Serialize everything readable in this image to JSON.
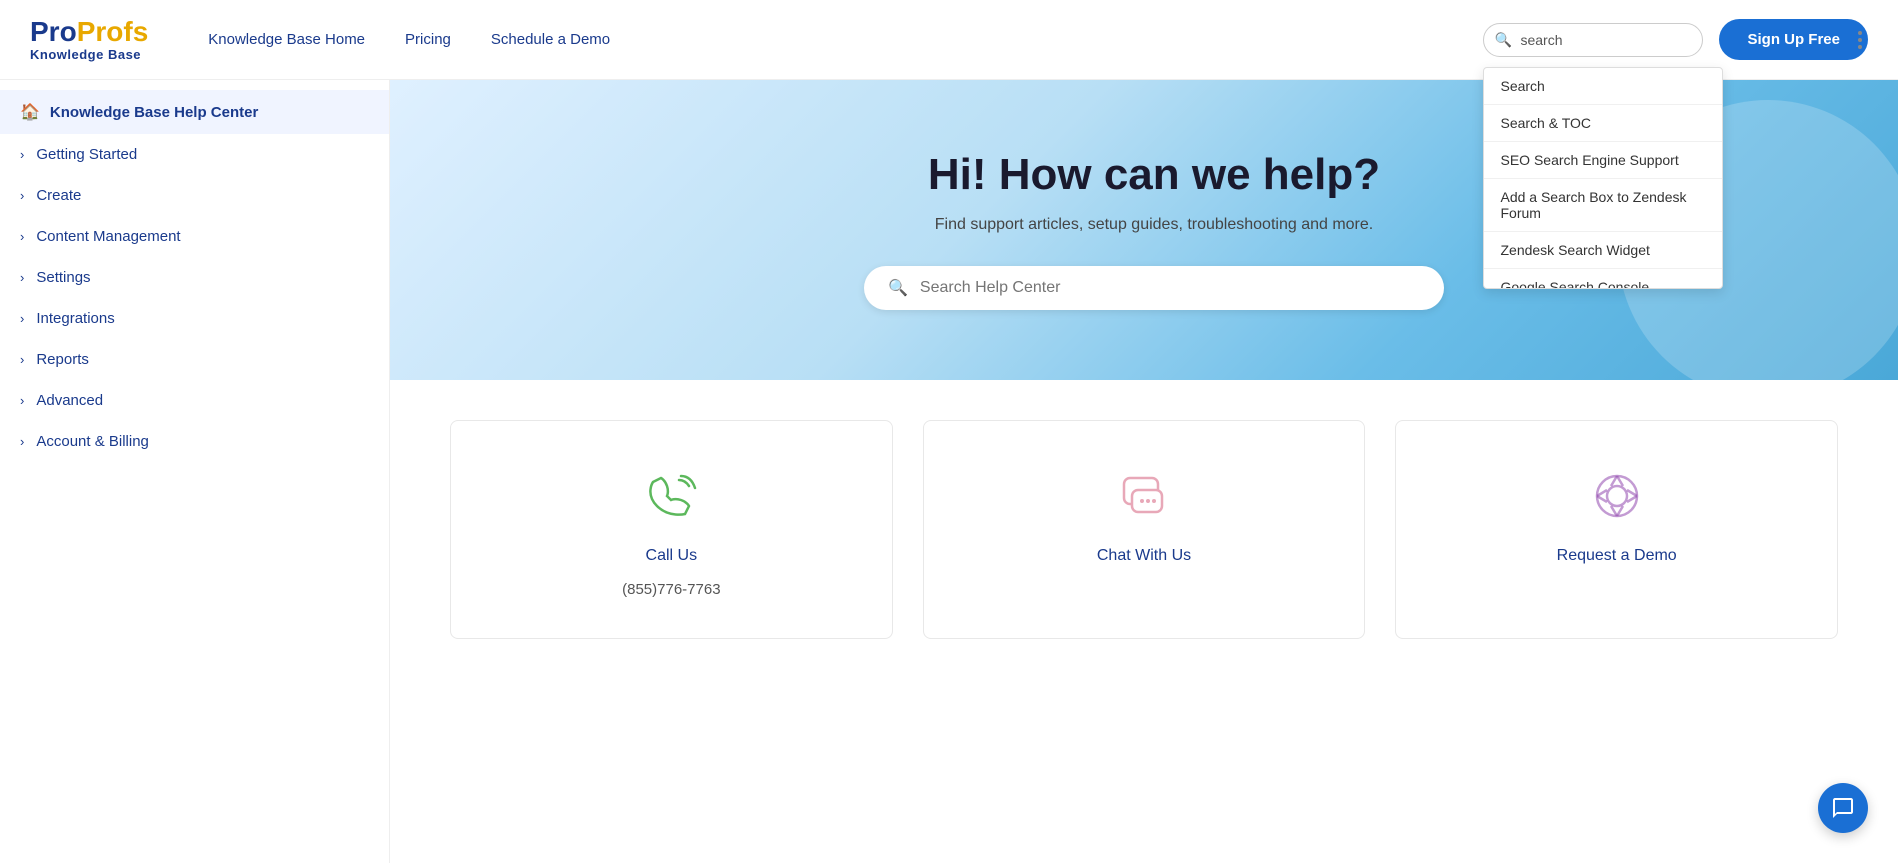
{
  "header": {
    "logo": {
      "pro": "Pro",
      "profs": "Profs",
      "sub": "Knowledge Base"
    },
    "nav": [
      {
        "label": "Knowledge Base Home",
        "id": "kb-home"
      },
      {
        "label": "Pricing",
        "id": "pricing"
      },
      {
        "label": "Schedule a Demo",
        "id": "schedule-demo"
      }
    ],
    "search_placeholder": "search",
    "signup_label": "Sign Up Free"
  },
  "dropdown": {
    "items": [
      {
        "label": "Search",
        "id": "search"
      },
      {
        "label": "Search & TOC",
        "id": "search-toc"
      },
      {
        "label": "SEO Search Engine Support",
        "id": "seo-search"
      },
      {
        "label": "Add a Search Box to Zendesk Forum",
        "id": "zendesk-forum"
      },
      {
        "label": "Zendesk Search Widget",
        "id": "zendesk-widget"
      },
      {
        "label": "Google Search Console",
        "id": "google-search"
      }
    ]
  },
  "sidebar": {
    "items": [
      {
        "label": "Knowledge Base Help Center",
        "id": "kb-help-center",
        "active": true,
        "icon": "home"
      },
      {
        "label": "Getting Started",
        "id": "getting-started"
      },
      {
        "label": "Create",
        "id": "create"
      },
      {
        "label": "Content Management",
        "id": "content-management"
      },
      {
        "label": "Settings",
        "id": "settings"
      },
      {
        "label": "Integrations",
        "id": "integrations"
      },
      {
        "label": "Reports",
        "id": "reports"
      },
      {
        "label": "Advanced",
        "id": "advanced"
      },
      {
        "label": "Account & Billing",
        "id": "account-billing"
      }
    ]
  },
  "hero": {
    "title": "Hi! How can we help?",
    "subtitle": "Find support articles, setup guides, troubleshooting and more.",
    "search_placeholder": "Search Help Center"
  },
  "cards": [
    {
      "id": "call-us",
      "label": "Call Us",
      "value": "(855)776-7763",
      "icon": "phone"
    },
    {
      "id": "chat-with-us",
      "label": "Chat With Us",
      "value": "",
      "icon": "chat"
    },
    {
      "id": "request-demo",
      "label": "Request a Demo",
      "value": "",
      "icon": "lifebuoy"
    }
  ],
  "chat_button": {
    "aria": "Open chat"
  }
}
